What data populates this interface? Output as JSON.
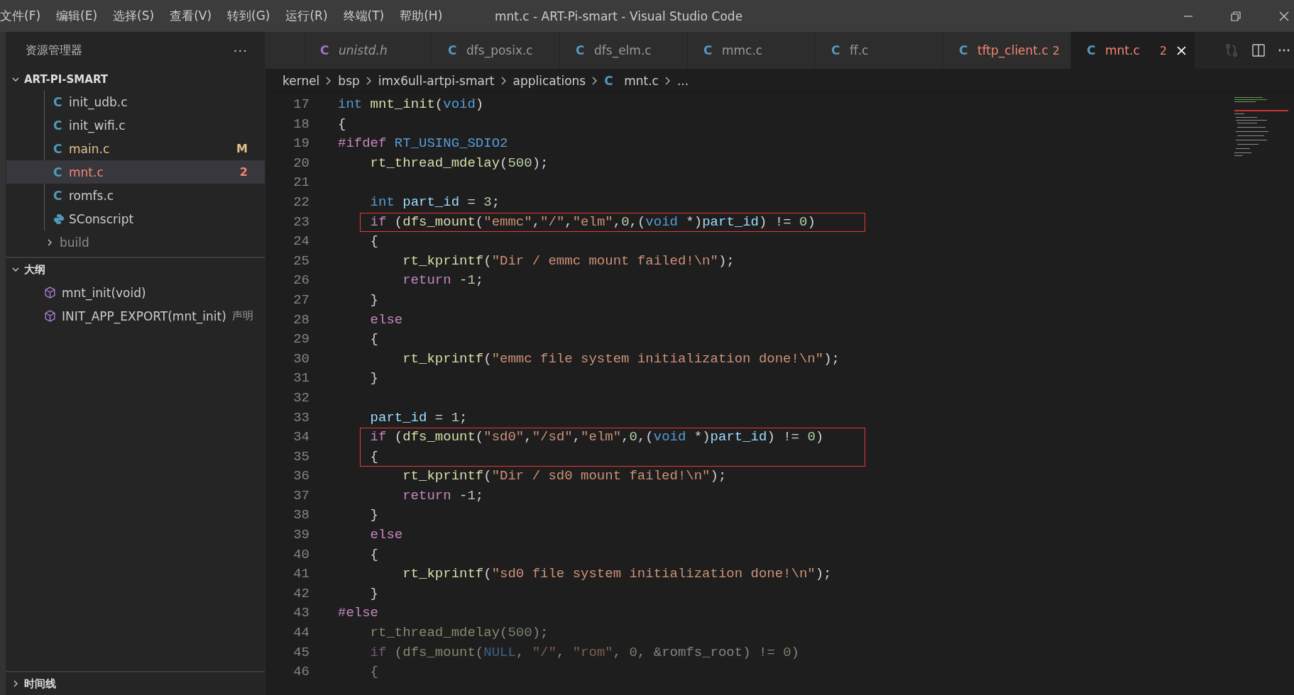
{
  "menu": [
    "文件(F)",
    "编辑(E)",
    "选择(S)",
    "查看(V)",
    "转到(G)",
    "运行(R)",
    "终端(T)",
    "帮助(H)"
  ],
  "window": {
    "title": "mnt.c - ART-Pi-smart - Visual Studio Code"
  },
  "sidebar": {
    "title": "资源管理器",
    "more": "···",
    "explorer": {
      "label": "ART-PI-SMART",
      "expanded": true,
      "items": [
        {
          "kind": "c",
          "icon": "C",
          "label": "init_udb.c",
          "modified": false,
          "has_errors": false,
          "selected": false
        },
        {
          "kind": "c",
          "icon": "C",
          "label": "init_wifi.c",
          "modified": false,
          "has_errors": false,
          "selected": false
        },
        {
          "kind": "c",
          "icon": "C",
          "label": "main.c",
          "modified": true,
          "has_errors": false,
          "badge": "M",
          "selected": false
        },
        {
          "kind": "c",
          "icon": "C",
          "label": "mnt.c",
          "has_errors": true,
          "badge": "2",
          "selected": true
        },
        {
          "kind": "c",
          "icon": "C",
          "label": "romfs.c",
          "modified": false,
          "has_errors": false,
          "selected": false
        },
        {
          "kind": "python",
          "label": "SConscript",
          "modified": false,
          "has_errors": false,
          "selected": false
        }
      ],
      "folders": [
        {
          "label": "build",
          "expanded": false
        }
      ]
    },
    "outline": {
      "label": "大纲",
      "expanded": true,
      "items": [
        {
          "label": "mnt_init(void)"
        },
        {
          "label": "INIT_APP_EXPORT(mnt_init)",
          "detail": "声明"
        }
      ]
    },
    "timeline": {
      "label": "时间线",
      "expanded": false
    }
  },
  "tabs": [
    {
      "icon": "C",
      "label": "unistd.h",
      "kind": "header",
      "preview": true,
      "has_errors": false,
      "selected": false
    },
    {
      "icon": "C",
      "label": "dfs_posix.c",
      "kind": "c",
      "preview": false,
      "has_errors": false,
      "selected": false
    },
    {
      "icon": "C",
      "label": "dfs_elm.c",
      "kind": "c",
      "preview": false,
      "has_errors": false,
      "selected": false
    },
    {
      "icon": "C",
      "label": "mmc.c",
      "kind": "c",
      "preview": false,
      "has_errors": false,
      "selected": false
    },
    {
      "icon": "C",
      "label": "ff.c",
      "kind": "c",
      "preview": false,
      "has_errors": false,
      "selected": false
    },
    {
      "icon": "C",
      "label": "tftp_client.c",
      "kind": "c",
      "preview": false,
      "has_errors": true,
      "badge": "2",
      "selected": false
    },
    {
      "icon": "C",
      "label": "mnt.c",
      "kind": "c",
      "preview": false,
      "has_errors": true,
      "badge": "2",
      "selected": true
    }
  ],
  "breadcrumb": [
    {
      "label": "kernel"
    },
    {
      "label": "bsp"
    },
    {
      "label": "imx6ull-artpi-smart"
    },
    {
      "label": "applications"
    },
    {
      "label": "mnt.c",
      "kind": "c",
      "icon": "C"
    },
    {
      "label": "..."
    }
  ],
  "code": {
    "lines": [
      {
        "number": "17",
        "inactive": false,
        "boxed": false,
        "tokens": [
          {
            "kind": "keyword",
            "text": "int"
          },
          {
            "kind": "function",
            "text": " mnt_init"
          },
          {
            "kind": "plain",
            "text": "("
          },
          {
            "kind": "keyword",
            "text": "void"
          },
          {
            "kind": "plain",
            "text": ")"
          }
        ]
      },
      {
        "number": "18",
        "inactive": false,
        "boxed": false,
        "tokens": [
          {
            "kind": "plain",
            "text": "{"
          }
        ]
      },
      {
        "number": "19",
        "inactive": false,
        "boxed": false,
        "tokens": [
          {
            "kind": "control",
            "text": "#ifdef"
          },
          {
            "kind": "keyword",
            "text": " RT_USING_SDIO2"
          }
        ]
      },
      {
        "number": "20",
        "inactive": false,
        "boxed": false,
        "tokens": [
          {
            "kind": "function",
            "text": "    rt_thread_mdelay"
          },
          {
            "kind": "plain",
            "text": "("
          },
          {
            "kind": "number",
            "text": "500"
          },
          {
            "kind": "plain",
            "text": ");"
          }
        ]
      },
      {
        "number": "21",
        "boxed": false
      },
      {
        "number": "22",
        "inactive": false,
        "boxed": false,
        "tokens": [
          {
            "kind": "keyword",
            "text": "    int"
          },
          {
            "kind": "variable",
            "text": " part_id"
          },
          {
            "kind": "plain",
            "text": " = "
          },
          {
            "kind": "number",
            "text": "3"
          },
          {
            "kind": "plain",
            "text": ";"
          }
        ]
      },
      {
        "number": "23",
        "inactive": false,
        "boxed": true,
        "tokens": [
          {
            "kind": "control",
            "text": "    if"
          },
          {
            "kind": "plain",
            "text": " ("
          },
          {
            "kind": "function",
            "text": "dfs_mount"
          },
          {
            "kind": "plain",
            "text": "("
          },
          {
            "kind": "string",
            "text": "\"emmc\""
          },
          {
            "kind": "plain",
            "text": ","
          },
          {
            "kind": "string",
            "text": "\"/\""
          },
          {
            "kind": "plain",
            "text": ","
          },
          {
            "kind": "string",
            "text": "\"elm\""
          },
          {
            "kind": "plain",
            "text": ","
          },
          {
            "kind": "number",
            "text": "0"
          },
          {
            "kind": "plain",
            "text": ",("
          },
          {
            "kind": "keyword",
            "text": "void"
          },
          {
            "kind": "plain",
            "text": " *)"
          },
          {
            "kind": "variable",
            "text": "part_id"
          },
          {
            "kind": "plain",
            "text": ") != "
          },
          {
            "kind": "number",
            "text": "0"
          },
          {
            "kind": "plain",
            "text": ")"
          }
        ]
      },
      {
        "number": "24",
        "inactive": false,
        "boxed": false,
        "tokens": [
          {
            "kind": "plain",
            "text": "    {"
          }
        ]
      },
      {
        "number": "25",
        "inactive": false,
        "boxed": false,
        "tokens": [
          {
            "kind": "function",
            "text": "        rt_kprintf"
          },
          {
            "kind": "plain",
            "text": "("
          },
          {
            "kind": "string",
            "text": "\"Dir / emmc mount failed!\\n\""
          },
          {
            "kind": "plain",
            "text": ");"
          }
        ]
      },
      {
        "number": "26",
        "inactive": false,
        "boxed": false,
        "tokens": [
          {
            "kind": "control",
            "text": "        return"
          },
          {
            "kind": "plain",
            "text": " -"
          },
          {
            "kind": "number",
            "text": "1"
          },
          {
            "kind": "plain",
            "text": ";"
          }
        ]
      },
      {
        "number": "27",
        "inactive": false,
        "boxed": false,
        "tokens": [
          {
            "kind": "plain",
            "text": "    }"
          }
        ]
      },
      {
        "number": "28",
        "inactive": false,
        "boxed": false,
        "tokens": [
          {
            "kind": "control",
            "text": "    else"
          }
        ]
      },
      {
        "number": "29",
        "inactive": false,
        "boxed": false,
        "tokens": [
          {
            "kind": "plain",
            "text": "    {"
          }
        ]
      },
      {
        "number": "30",
        "inactive": false,
        "boxed": false,
        "tokens": [
          {
            "kind": "function",
            "text": "        rt_kprintf"
          },
          {
            "kind": "plain",
            "text": "("
          },
          {
            "kind": "string",
            "text": "\"emmc file system initialization done!\\n\""
          },
          {
            "kind": "plain",
            "text": ");"
          }
        ]
      },
      {
        "number": "31",
        "inactive": false,
        "boxed": false,
        "tokens": [
          {
            "kind": "plain",
            "text": "    }"
          }
        ]
      },
      {
        "number": "32",
        "boxed": false
      },
      {
        "number": "33",
        "inactive": false,
        "boxed": false,
        "tokens": [
          {
            "kind": "variable",
            "text": "    part_id"
          },
          {
            "kind": "plain",
            "text": " = "
          },
          {
            "kind": "number",
            "text": "1"
          },
          {
            "kind": "plain",
            "text": ";"
          }
        ]
      },
      {
        "number": "34",
        "inactive": false,
        "boxed": true,
        "tokens": [
          {
            "kind": "control",
            "text": "    if"
          },
          {
            "kind": "plain",
            "text": " ("
          },
          {
            "kind": "function",
            "text": "dfs_mount"
          },
          {
            "kind": "plain",
            "text": "("
          },
          {
            "kind": "string",
            "text": "\"sd0\""
          },
          {
            "kind": "plain",
            "text": ","
          },
          {
            "kind": "string",
            "text": "\"/sd\""
          },
          {
            "kind": "plain",
            "text": ","
          },
          {
            "kind": "string",
            "text": "\"elm\""
          },
          {
            "kind": "plain",
            "text": ","
          },
          {
            "kind": "number",
            "text": "0"
          },
          {
            "kind": "plain",
            "text": ",("
          },
          {
            "kind": "keyword",
            "text": "void"
          },
          {
            "kind": "plain",
            "text": " *)"
          },
          {
            "kind": "variable",
            "text": "part_id"
          },
          {
            "kind": "plain",
            "text": ") != "
          },
          {
            "kind": "number",
            "text": "0"
          },
          {
            "kind": "plain",
            "text": ")"
          }
        ]
      },
      {
        "number": "35",
        "inactive": false,
        "boxed": true,
        "tokens": [
          {
            "kind": "plain",
            "text": "    {"
          }
        ]
      },
      {
        "number": "36",
        "inactive": false,
        "boxed": false,
        "tokens": [
          {
            "kind": "function",
            "text": "        rt_kprintf"
          },
          {
            "kind": "plain",
            "text": "("
          },
          {
            "kind": "string",
            "text": "\"Dir / sd0 mount failed!\\n\""
          },
          {
            "kind": "plain",
            "text": ");"
          }
        ]
      },
      {
        "number": "37",
        "inactive": false,
        "boxed": false,
        "tokens": [
          {
            "kind": "control",
            "text": "        return"
          },
          {
            "kind": "plain",
            "text": " -"
          },
          {
            "kind": "number",
            "text": "1"
          },
          {
            "kind": "plain",
            "text": ";"
          }
        ]
      },
      {
        "number": "38",
        "inactive": false,
        "boxed": false,
        "tokens": [
          {
            "kind": "plain",
            "text": "    }"
          }
        ]
      },
      {
        "number": "39",
        "inactive": false,
        "boxed": false,
        "tokens": [
          {
            "kind": "control",
            "text": "    else"
          }
        ]
      },
      {
        "number": "40",
        "inactive": false,
        "boxed": false,
        "tokens": [
          {
            "kind": "plain",
            "text": "    {"
          }
        ]
      },
      {
        "number": "41",
        "inactive": false,
        "boxed": false,
        "tokens": [
          {
            "kind": "function",
            "text": "        rt_kprintf"
          },
          {
            "kind": "plain",
            "text": "("
          },
          {
            "kind": "string",
            "text": "\"sd0 file system initialization done!\\n\""
          },
          {
            "kind": "plain",
            "text": ");"
          }
        ]
      },
      {
        "number": "42",
        "inactive": false,
        "boxed": false,
        "tokens": [
          {
            "kind": "plain",
            "text": "    }"
          }
        ]
      },
      {
        "number": "43",
        "inactive": false,
        "boxed": false,
        "tokens": [
          {
            "kind": "control",
            "text": "#else"
          }
        ]
      },
      {
        "number": "44",
        "inactive": true,
        "boxed": false,
        "tokens": [
          {
            "kind": "function",
            "text": "    rt_thread_mdelay"
          },
          {
            "kind": "plain",
            "text": "("
          },
          {
            "kind": "number",
            "text": "500"
          },
          {
            "kind": "plain",
            "text": ");"
          }
        ]
      },
      {
        "number": "45",
        "inactive": true,
        "boxed": false,
        "tokens": [
          {
            "kind": "control",
            "text": "    if"
          },
          {
            "kind": "plain",
            "text": " ("
          },
          {
            "kind": "function",
            "text": "dfs_mount"
          },
          {
            "kind": "plain",
            "text": "("
          },
          {
            "kind": "keyword",
            "text": "NULL"
          },
          {
            "kind": "plain",
            "text": ", "
          },
          {
            "kind": "string",
            "text": "\"/\""
          },
          {
            "kind": "plain",
            "text": ", "
          },
          {
            "kind": "string",
            "text": "\"rom\""
          },
          {
            "kind": "plain",
            "text": ", "
          },
          {
            "kind": "number",
            "text": "0"
          },
          {
            "kind": "plain",
            "text": ", &romfs_root) != "
          },
          {
            "kind": "number",
            "text": "0"
          },
          {
            "kind": "plain",
            "text": ")"
          }
        ]
      },
      {
        "number": "46",
        "inactive": true,
        "boxed": false,
        "tokens": [
          {
            "kind": "plain",
            "text": "    {"
          }
        ]
      }
    ]
  }
}
